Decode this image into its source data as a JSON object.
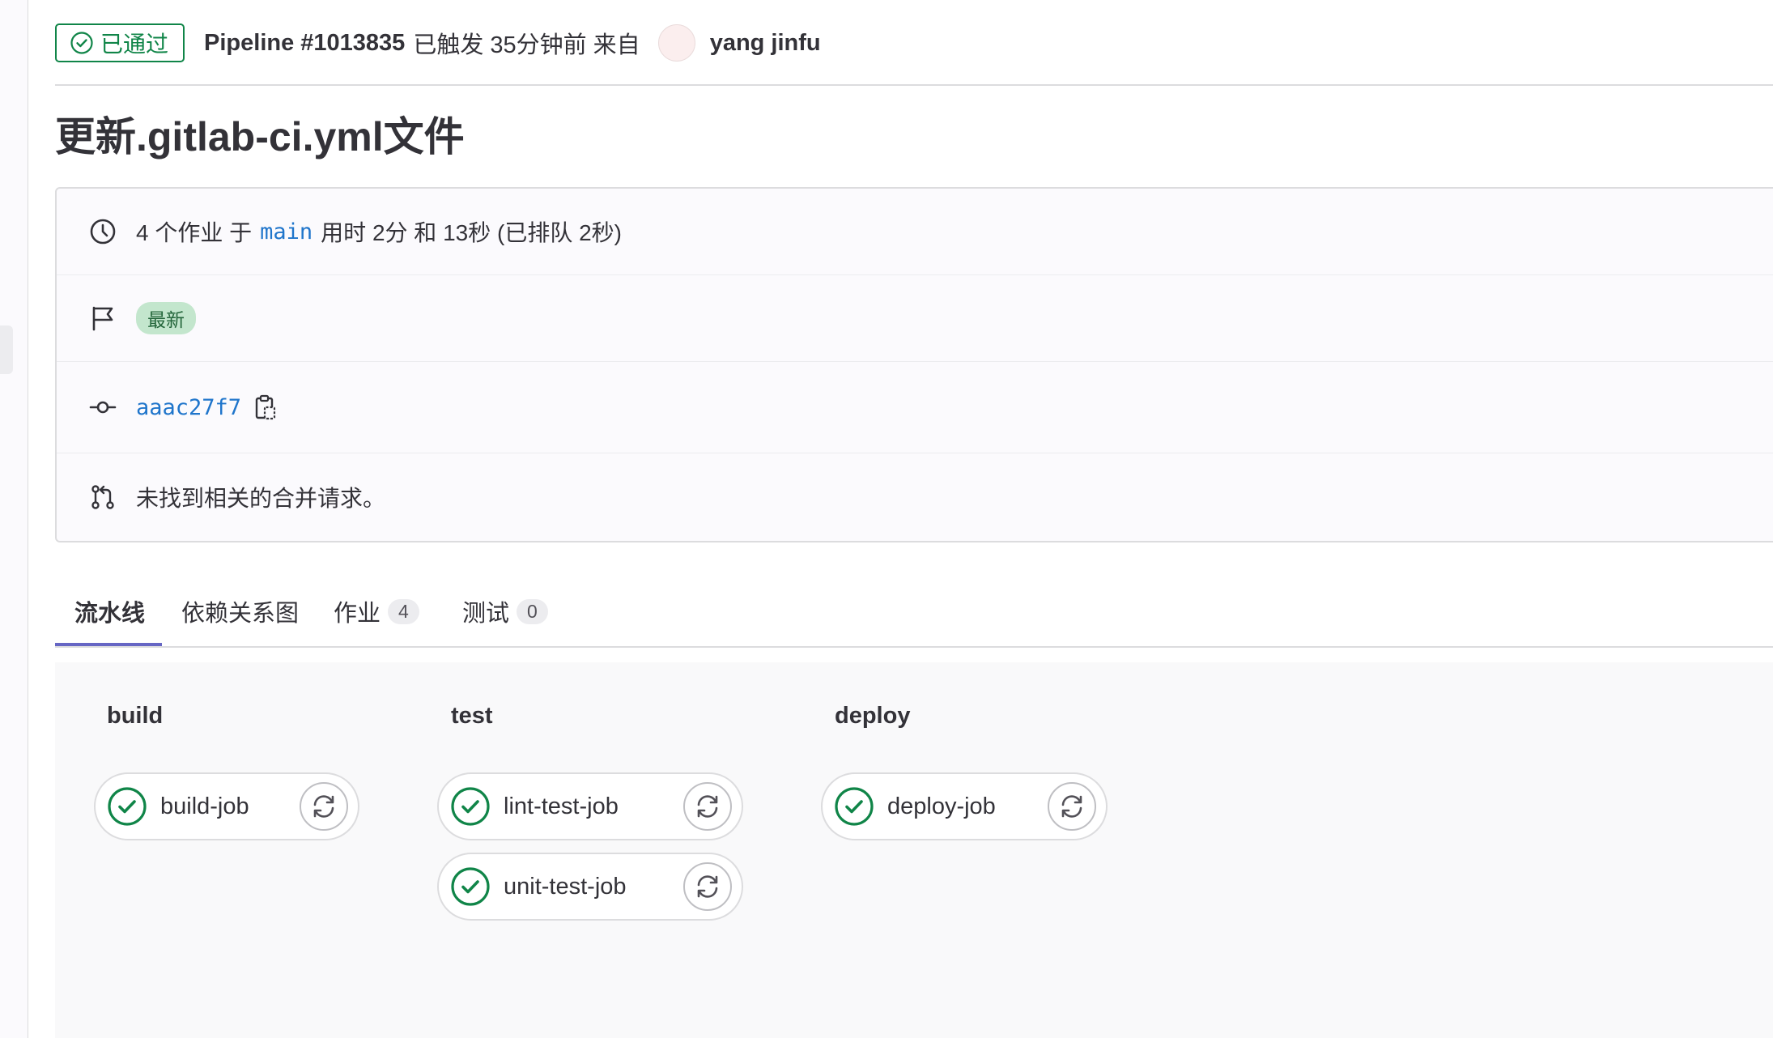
{
  "header": {
    "status_badge": "已通过",
    "pipeline_id": "Pipeline #1013835",
    "trigger_text": "已触发 35分钟前 来自",
    "user_name": "yang jinfu"
  },
  "title": "更新.gitlab-ci.yml文件",
  "info": {
    "jobs_prefix": "4 个作业 于",
    "branch": "main",
    "jobs_suffix": "用时 2分 和 13秒 (已排队 2秒)",
    "latest_badge": "最新",
    "commit_sha": "aaac27f7",
    "merge_request_text": "未找到相关的合并请求。"
  },
  "tabs": [
    {
      "label": "流水线",
      "count": null,
      "active": true
    },
    {
      "label": "依赖关系图",
      "count": null,
      "active": false
    },
    {
      "label": "作业",
      "count": "4",
      "active": false
    },
    {
      "label": "测试",
      "count": "0",
      "active": false
    }
  ],
  "stages": [
    {
      "name": "build",
      "jobs": [
        {
          "name": "build-job",
          "status": "success"
        }
      ]
    },
    {
      "name": "test",
      "jobs": [
        {
          "name": "lint-test-job",
          "status": "success"
        },
        {
          "name": "unit-test-job",
          "status": "success"
        }
      ]
    },
    {
      "name": "deploy",
      "jobs": [
        {
          "name": "deploy-job",
          "status": "success"
        }
      ]
    }
  ],
  "icons": {
    "status": "check-circle-icon",
    "duration": "clock-icon",
    "latest": "flag-icon",
    "commit": "commit-icon",
    "copy": "clipboard-icon",
    "merge_request": "merge-request-icon",
    "retry": "retry-icon"
  },
  "colors": {
    "success": "#108548",
    "link": "#1f75cb",
    "tab_active": "#6666c4",
    "latest_badge_bg": "#c3e6cd"
  }
}
